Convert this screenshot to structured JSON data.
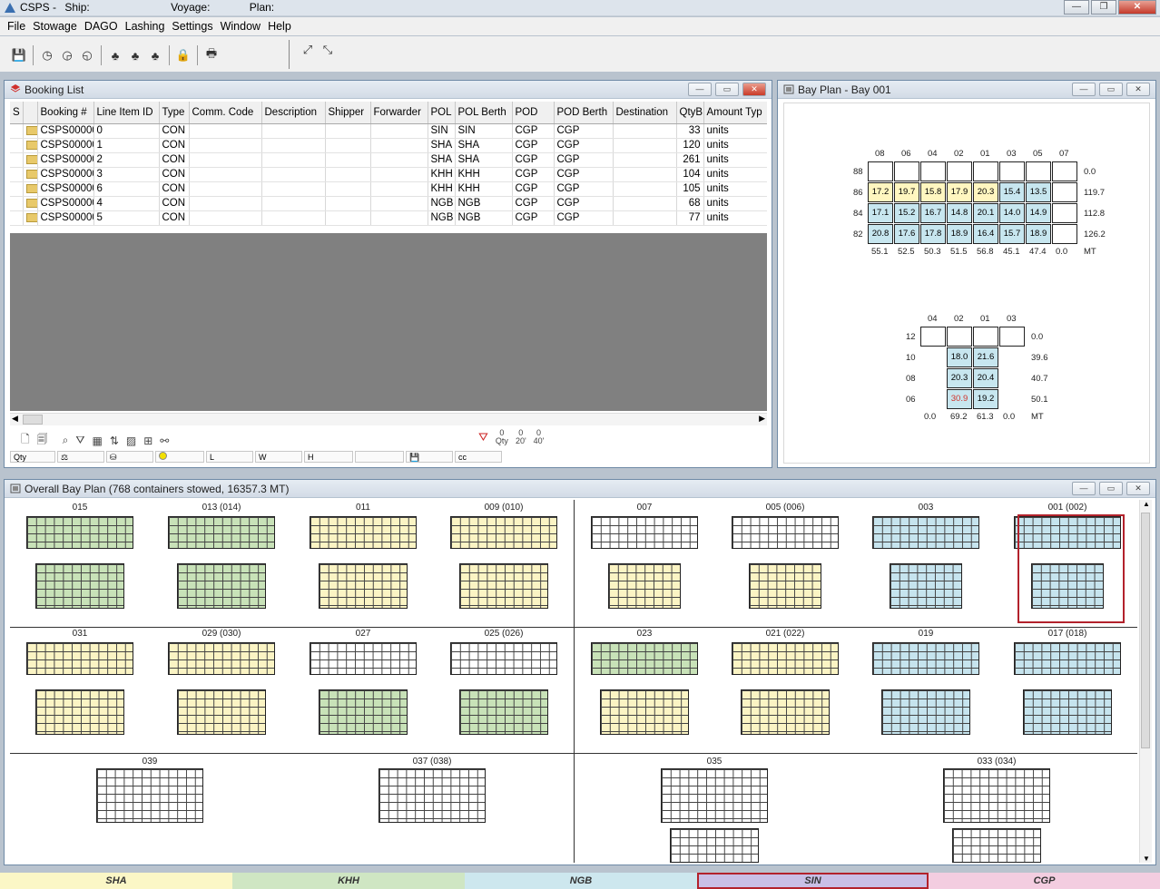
{
  "app": {
    "title_parts": [
      "CSPS -",
      "Ship:",
      "Voyage:",
      "Plan:"
    ],
    "colors": {
      "sha": "#fbf7c6",
      "khh": "#cfe6c3",
      "ngb": "#cde7ee",
      "sin": "#c9bfe6",
      "cgp": "#f3cde0",
      "sin_border": "#b3222c"
    }
  },
  "menu": [
    "File",
    "Stowage",
    "DAGO",
    "Lashing",
    "Settings",
    "Window",
    "Help"
  ],
  "toolbar_icons": [
    "save-icon",
    "clock-icon",
    "clock-arrow-icon",
    "clock-reset-icon",
    "tree-icon",
    "tree-alt-icon",
    "tree-select-icon",
    "lock-icon",
    "print-icon",
    "crane-left-icon",
    "crane-right-icon"
  ],
  "booking_list": {
    "title": "Booking List",
    "columns": [
      "S",
      "",
      "Booking #",
      "Line Item ID",
      "Type",
      "Comm. Code",
      "Description",
      "Shipper",
      "Forwarder",
      "POL",
      "POL Berth",
      "POD",
      "POD Berth",
      "Destination",
      "QtyB",
      "Amount Typ"
    ],
    "rows": [
      {
        "booking": "CSPS00000",
        "item": "0",
        "type": "CON",
        "pol": "SIN",
        "polb": "SIN",
        "pod": "CGP",
        "podb": "CGP",
        "qty": "33",
        "amt": "units"
      },
      {
        "booking": "CSPS00000",
        "item": "1",
        "type": "CON",
        "pol": "SHA",
        "polb": "SHA",
        "pod": "CGP",
        "podb": "CGP",
        "qty": "120",
        "amt": "units"
      },
      {
        "booking": "CSPS00000",
        "item": "2",
        "type": "CON",
        "pol": "SHA",
        "polb": "SHA",
        "pod": "CGP",
        "podb": "CGP",
        "qty": "261",
        "amt": "units"
      },
      {
        "booking": "CSPS00000",
        "item": "3",
        "type": "CON",
        "pol": "KHH",
        "polb": "KHH",
        "pod": "CGP",
        "podb": "CGP",
        "qty": "104",
        "amt": "units"
      },
      {
        "booking": "CSPS00000",
        "item": "6",
        "type": "CON",
        "pol": "KHH",
        "polb": "KHH",
        "pod": "CGP",
        "podb": "CGP",
        "qty": "105",
        "amt": "units"
      },
      {
        "booking": "CSPS00000",
        "item": "4",
        "type": "CON",
        "pol": "NGB",
        "polb": "NGB",
        "pod": "CGP",
        "podb": "CGP",
        "qty": "68",
        "amt": "units"
      },
      {
        "booking": "CSPS00000",
        "item": "5",
        "type": "CON",
        "pol": "NGB",
        "polb": "NGB",
        "pod": "CGP",
        "podb": "CGP",
        "qty": "77",
        "amt": "units"
      }
    ],
    "status": [
      "Qty",
      "",
      "",
      "",
      "L",
      "W",
      "H",
      "",
      "",
      "cc"
    ],
    "filter_labels": {
      "f1": "0",
      "f1b": "Qty",
      "f2": "0",
      "f2b": "20'",
      "f3": "0",
      "f3b": "40'"
    }
  },
  "bay_plan": {
    "title": "Bay Plan - Bay 001",
    "deck": {
      "cols": [
        "08",
        "06",
        "04",
        "02",
        "01",
        "03",
        "05",
        "07"
      ],
      "rows": [
        {
          "tier": "88",
          "cells": [
            "",
            "",
            "",
            "",
            "",
            "",
            "",
            ""
          ],
          "total": "0.0"
        },
        {
          "tier": "86",
          "cells": [
            "17.2",
            "19.7",
            "15.8",
            "17.9",
            "20.3",
            "15.4",
            "13.5",
            ""
          ],
          "total": "119.7"
        },
        {
          "tier": "84",
          "cells": [
            "17.1",
            "15.2",
            "16.7",
            "14.8",
            "20.1",
            "14.0",
            "14.9",
            ""
          ],
          "total": "112.8"
        },
        {
          "tier": "82",
          "cells": [
            "20.8",
            "17.6",
            "17.8",
            "18.9",
            "16.4",
            "15.7",
            "18.9",
            ""
          ],
          "total": "126.2"
        }
      ],
      "colors": [
        [
          "w",
          "w",
          "w",
          "w",
          "w",
          "w",
          "w",
          "w"
        ],
        [
          "y",
          "y",
          "y",
          "y",
          "y",
          "b",
          "b",
          "w"
        ],
        [
          "b",
          "b",
          "b",
          "b",
          "b",
          "b",
          "b",
          "w"
        ],
        [
          "b",
          "b",
          "b",
          "b",
          "b",
          "b",
          "b",
          "w"
        ]
      ],
      "col_totals": [
        "55.1",
        "52.5",
        "50.3",
        "51.5",
        "56.8",
        "45.1",
        "47.4",
        "0.0"
      ],
      "unit": "MT"
    },
    "hold": {
      "cols": [
        "04",
        "02",
        "01",
        "03"
      ],
      "rows": [
        {
          "tier": "12",
          "cells": [
            "",
            "",
            "",
            ""
          ],
          "total": "0.0"
        },
        {
          "tier": "10",
          "cells": [
            "",
            "18.0",
            "21.6",
            ""
          ],
          "total": "39.6"
        },
        {
          "tier": "08",
          "cells": [
            "",
            "20.3",
            "20.4",
            ""
          ],
          "total": "40.7"
        },
        {
          "tier": "06",
          "cells": [
            "",
            "30.9",
            "19.2",
            ""
          ],
          "total": "50.1"
        }
      ],
      "col_totals": [
        "0.0",
        "69.2",
        "61.3",
        "0.0"
      ],
      "unit": "MT"
    }
  },
  "overall": {
    "title": "Overall Bay Plan (768 containers stowed, 16357.3 MT)",
    "bays_row1": [
      "015",
      "013 (014)",
      "011",
      "009 (010)",
      "007",
      "005 (006)",
      "003",
      "001 (002)"
    ],
    "bays_row2": [
      "031",
      "029 (030)",
      "027",
      "025 (026)",
      "023",
      "021 (022)",
      "019",
      "017 (018)"
    ],
    "bays_row3": [
      "039",
      "037 (038)",
      "035",
      "033 (034)"
    ]
  },
  "legend": [
    "SHA",
    "KHH",
    "NGB",
    "SIN",
    "CGP"
  ]
}
